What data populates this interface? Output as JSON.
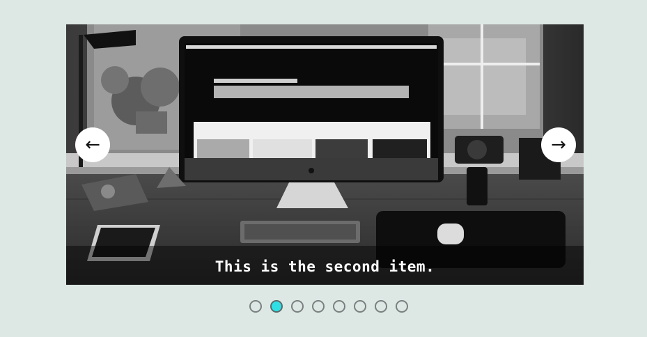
{
  "slider": {
    "caption": "This is the second item.",
    "prev_icon": "←",
    "next_icon": "→",
    "dot_count": 8,
    "active_index": 1,
    "accent_color": "#2ee0e6"
  },
  "photo": {
    "subject": "desk-workspace-monochrome",
    "icon": "image-icon"
  }
}
